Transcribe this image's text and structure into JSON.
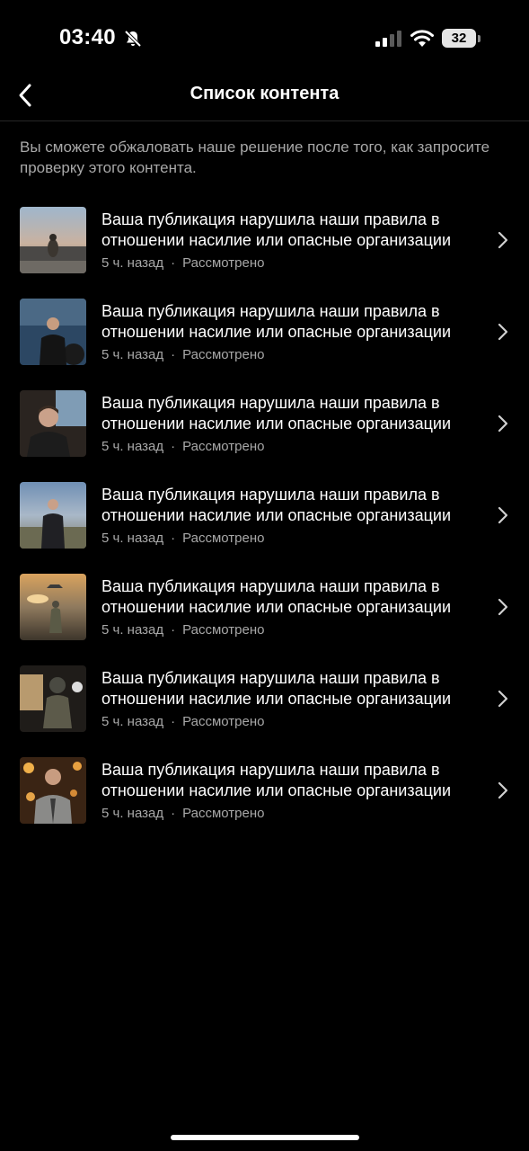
{
  "status_bar": {
    "time": "03:40",
    "battery": "32"
  },
  "header": {
    "title": "Список контента"
  },
  "description": "Вы сможете обжаловать наше решение после того, как запросите проверку этого контента.",
  "items": [
    {
      "title": "Ваша публикация нарушила наши правила в отношении насилие или опасные организации",
      "time": "5 ч. назад",
      "separator": "·",
      "status": "Рассмотрено"
    },
    {
      "title": "Ваша публикация нарушила наши правила в отношении насилие или опасные организации",
      "time": "5 ч. назад",
      "separator": "·",
      "status": "Рассмотрено"
    },
    {
      "title": "Ваша публикация нарушила наши правила в отношении насилие или опасные организации",
      "time": "5 ч. назад",
      "separator": "·",
      "status": "Рассмотрено"
    },
    {
      "title": "Ваша публикация нарушила наши правила в отношении насилие или опасные организации",
      "time": "5 ч. назад",
      "separator": "·",
      "status": "Рассмотрено"
    },
    {
      "title": "Ваша публикация нарушила наши правила в отношении насилие или опасные организации",
      "time": "5 ч. назад",
      "separator": "·",
      "status": "Рассмотрено"
    },
    {
      "title": "Ваша публикация нарушила наши правила в отношении насилие или опасные организации",
      "time": "5 ч. назад",
      "separator": "·",
      "status": "Рассмотрено"
    },
    {
      "title": "Ваша публикация нарушила наши правила в отношении насилие или опасные организации",
      "time": "5 ч. назад",
      "separator": "·",
      "status": "Рассмотрено"
    }
  ],
  "icons": {
    "back": "chevron-left-icon",
    "row_arrow": "chevron-right-icon",
    "silent": "bell-slash-icon",
    "signal": "cellular-signal-icon",
    "wifi": "wifi-icon"
  },
  "colors": {
    "background": "#000000",
    "text_primary": "#ffffff",
    "text_secondary": "#a8a8a8"
  }
}
